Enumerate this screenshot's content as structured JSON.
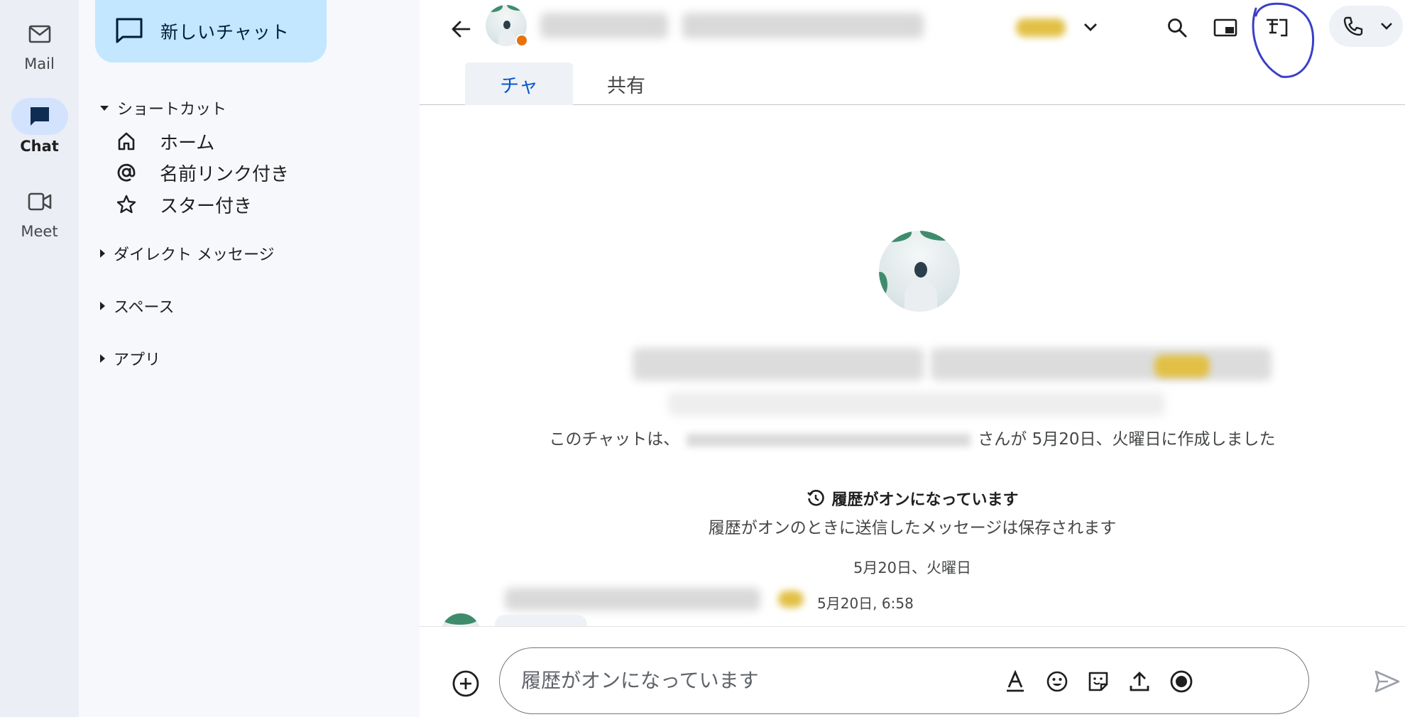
{
  "rail": {
    "items": [
      {
        "label": "Mail",
        "icon": "mail-icon"
      },
      {
        "label": "Chat",
        "icon": "chat-icon",
        "active": true
      },
      {
        "label": "Meet",
        "icon": "meet-icon"
      }
    ]
  },
  "sidebar": {
    "new_chat_label": "新しいチャット",
    "shortcuts_heading": "ショートカット",
    "shortcuts": [
      {
        "label": "ホーム",
        "icon": "home-icon"
      },
      {
        "label": "名前リンク付き",
        "icon": "at-icon"
      },
      {
        "label": "スター付き",
        "icon": "star-icon"
      }
    ],
    "sections": [
      {
        "label": "ダイレクト メッセージ"
      },
      {
        "label": "スペース"
      },
      {
        "label": "アプリ"
      }
    ]
  },
  "header": {
    "tabs": [
      {
        "label": "チャ",
        "active": true
      },
      {
        "label": "共有",
        "active": false
      }
    ]
  },
  "conversation": {
    "created_prefix": "このチャットは、",
    "created_suffix": "さんが 5月20日、火曜日に作成しました",
    "history_title": "履歴がオンになっています",
    "history_desc": "履歴がオンのときに送信したメッセージは保存されます",
    "date_divider": "5月20日、火曜日",
    "message_time": "5月20日, 6:58"
  },
  "composer": {
    "placeholder": "履歴がオンになっています"
  },
  "colors": {
    "accent": "#0b57d0",
    "new_chat_bg": "#c2e7ff",
    "sidebar_bg": "#f6f8fc",
    "rail_bg": "#ebeef5",
    "annotation": "#3b3fc7",
    "status_badge": "#e8710a"
  }
}
